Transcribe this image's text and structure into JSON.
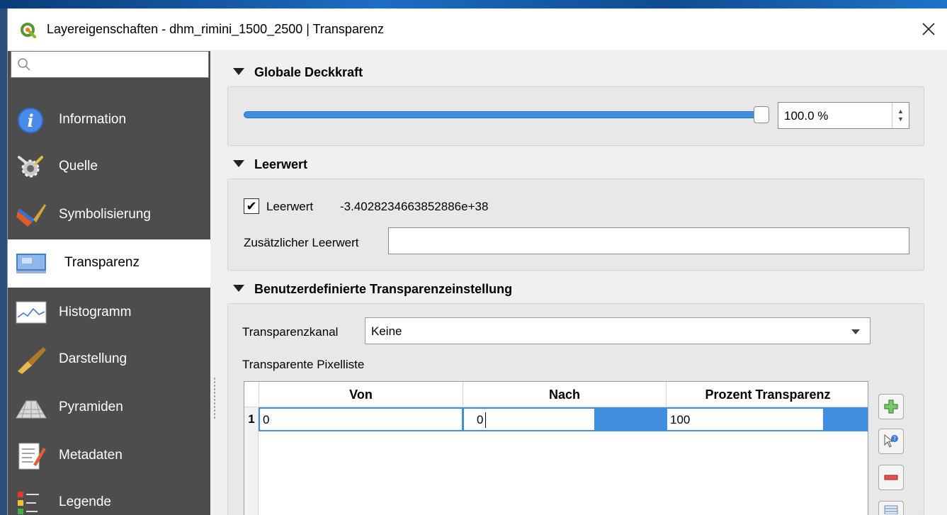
{
  "window": {
    "title": "Layereigenschaften - dhm_rimini_1500_2500 | Transparenz",
    "close_label": "✕"
  },
  "search": {
    "placeholder": ""
  },
  "sidebar": {
    "items": [
      {
        "label": "Information",
        "icon": "info-icon"
      },
      {
        "label": "Quelle",
        "icon": "source-wrench-icon"
      },
      {
        "label": "Symbolisierung",
        "icon": "paintbrush-icon"
      },
      {
        "label": "Transparenz",
        "icon": "transparency-icon",
        "active": true
      },
      {
        "label": "Histogramm",
        "icon": "histogram-icon"
      },
      {
        "label": "Darstellung",
        "icon": "render-brush-icon"
      },
      {
        "label": "Pyramiden",
        "icon": "pyramid-icon"
      },
      {
        "label": "Metadaten",
        "icon": "metadata-icon"
      },
      {
        "label": "Legende",
        "icon": "legend-icon"
      }
    ]
  },
  "opacity": {
    "heading": "Globale Deckkraft",
    "value": "100.0 %",
    "percent": 100
  },
  "nodata": {
    "heading": "Leerwert",
    "checkbox_label": "Leerwert",
    "checked": true,
    "value": "-3.4028234663852886e+38",
    "additional_label": "Zusätzlicher Leerwert",
    "additional_value": ""
  },
  "custom": {
    "heading": "Benutzerdefinierte Transparenzeinstellung",
    "channel_label": "Transparenzkanal",
    "channel_value": "Keine",
    "list_label": "Transparente Pixelliste",
    "columns": [
      "Von",
      "Nach",
      "Prozent Transparenz"
    ],
    "rows": [
      {
        "num": "1",
        "von": "0",
        "nach": "0",
        "prozent": "100"
      }
    ]
  },
  "colors": {
    "accent": "#3f8ee0",
    "sidebar_bg": "#4d4d4d"
  }
}
